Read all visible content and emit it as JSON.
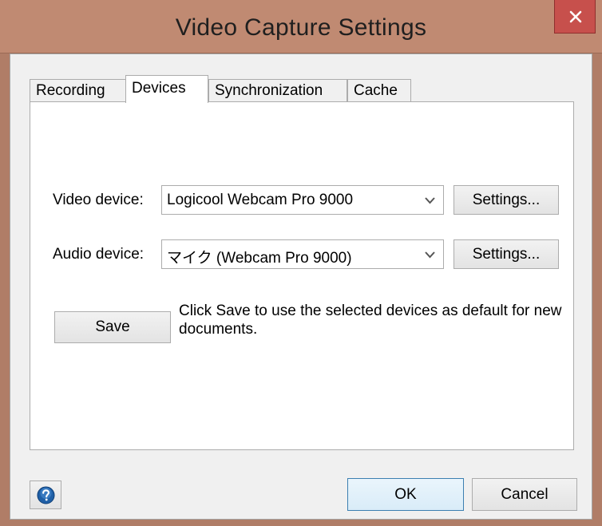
{
  "window": {
    "title": "Video Capture Settings",
    "close_icon": "close-icon"
  },
  "tabs": [
    {
      "label": "Recording",
      "active": false
    },
    {
      "label": "Devices",
      "active": true
    },
    {
      "label": "Synchronization",
      "active": false
    },
    {
      "label": "Cache",
      "active": false
    }
  ],
  "devices": {
    "video_label": "Video device:",
    "video_value": "Logicool Webcam Pro 9000",
    "video_settings_label": "Settings...",
    "audio_label": "Audio device:",
    "audio_value": "マイク (Webcam Pro 9000)",
    "audio_settings_label": "Settings...",
    "save_label": "Save",
    "save_hint": "Click Save to use the selected devices as default for new documents."
  },
  "footer": {
    "help_icon": "help-icon",
    "ok_label": "OK",
    "cancel_label": "Cancel"
  },
  "colors": {
    "titlebar": "#c08a72",
    "close_button": "#c7504c",
    "default_button_border": "#3c7fb1",
    "help_icon": "#1f5fa6"
  }
}
